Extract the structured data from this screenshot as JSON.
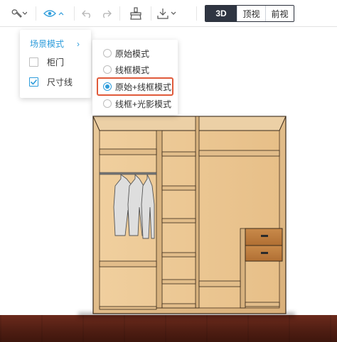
{
  "toolbar": {
    "tools_icon": "wrench-icon",
    "view_icon": "eye-icon",
    "undo_icon": "undo-icon",
    "redo_icon": "redo-icon",
    "clear_icon": "brush-icon",
    "download_icon": "download-icon",
    "view_modes": [
      {
        "label": "3D",
        "active": true
      },
      {
        "label": "顶视",
        "active": false
      },
      {
        "label": "前视",
        "active": false
      }
    ],
    "accent_color": "#2d9cdb"
  },
  "display_menu": {
    "scene_mode_label": "场景模式",
    "items": [
      {
        "label": "柜门",
        "checked": false
      },
      {
        "label": "尺寸线",
        "checked": true
      }
    ]
  },
  "scene_mode_submenu": {
    "options": [
      {
        "label": "原始模式",
        "selected": false
      },
      {
        "label": "线框模式",
        "selected": false
      },
      {
        "label": "原始+线框模式",
        "selected": true,
        "highlighted": true
      },
      {
        "label": "线框+光影模式",
        "selected": false
      }
    ],
    "highlight_color": "#e05a3a"
  }
}
